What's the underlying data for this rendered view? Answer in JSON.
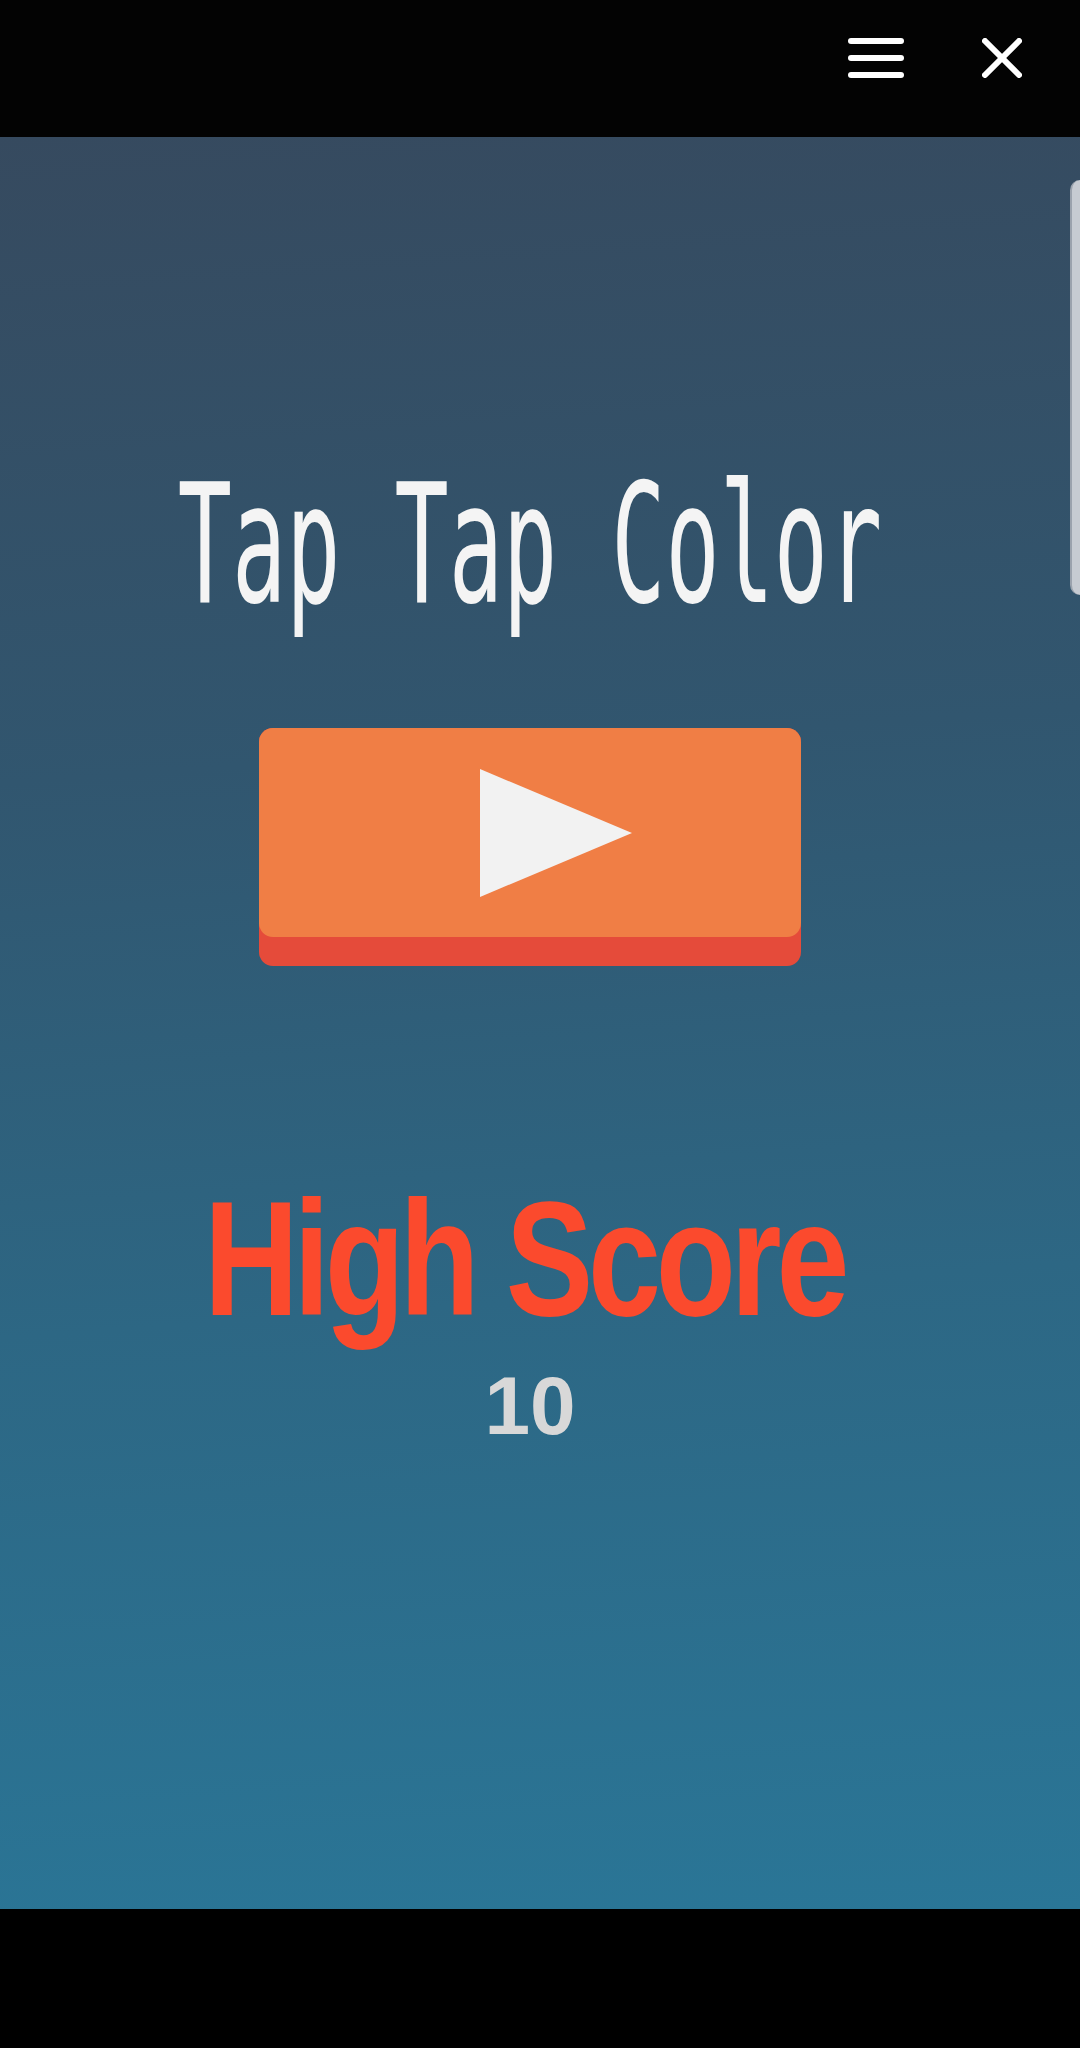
{
  "title": "Tap Tap Color",
  "high_score": {
    "label": "High Score",
    "value": "10"
  }
}
